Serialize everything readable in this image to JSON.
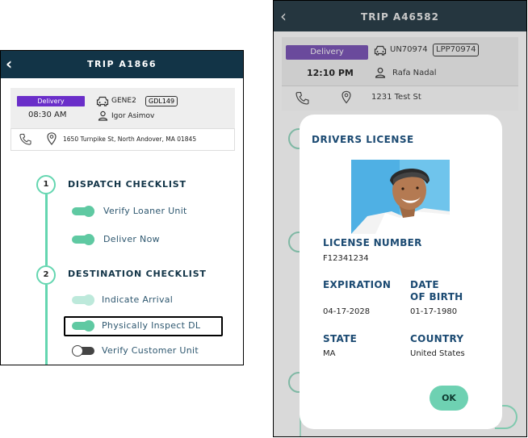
{
  "left_screen": {
    "back_glyph": "‹",
    "title": "TRIP A1866",
    "trip_type": "Delivery",
    "time": "08:30 AM",
    "unit_id": "GENE2",
    "plate": "GDL149",
    "driver": "Igor Asimov",
    "address": "1650 Turnpike St, North Andover, MA 01845",
    "sections": [
      {
        "number": "1",
        "title": "DISPATCH CHECKLIST"
      },
      {
        "number": "2",
        "title": "DESTINATION CHECKLIST"
      }
    ],
    "checklist": [
      {
        "label": "Verify Loaner Unit",
        "state": "on"
      },
      {
        "label": "Deliver Now",
        "state": "on"
      },
      {
        "label": "Indicate Arrival",
        "state": "on-disabled"
      },
      {
        "label": "Physically Inspect DL",
        "state": "on"
      },
      {
        "label": "Verify Customer Unit",
        "state": "off"
      }
    ]
  },
  "right_screen": {
    "back_glyph": "‹",
    "title": "TRIP A46582",
    "trip_type": "Delivery",
    "time": "12:10 PM",
    "unit_id": "UN70974",
    "plate": "LPP70974",
    "driver": "Rafa Nadal",
    "address": "1231 Test St"
  },
  "modal": {
    "title": "DRIVERS LICENSE",
    "license_number_label": "LICENSE NUMBER",
    "license_number": "F12341234",
    "expiration_label": "EXPIRATION",
    "expiration": "04-17-2028",
    "dob_label_1": "DATE",
    "dob_label_2": "OF BIRTH",
    "dob": "01-17-1980",
    "state_label": "STATE",
    "state": "MA",
    "country_label": "COUNTRY",
    "country": "United States",
    "ok_label": "OK"
  },
  "colors": {
    "left_header": "#123447",
    "right_header": "#25363f",
    "accent_green": "#5fc9a2",
    "delivery_purple": "#6a2ec9",
    "heading_blue": "#1b4a72"
  }
}
